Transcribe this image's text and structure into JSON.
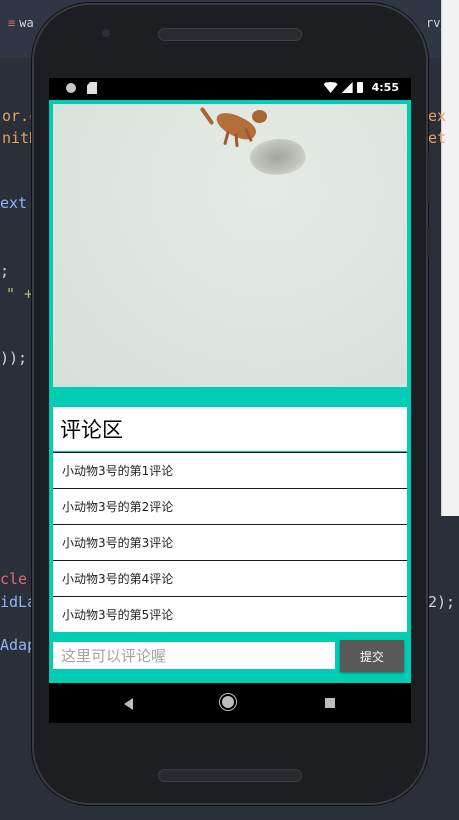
{
  "ide": {
    "tab_left": "wa",
    "tab_right": "rv_",
    "code_fragments": [
      {
        "text": "or.c",
        "color": "#e5a15a"
      },
      {
        "text": "nitD",
        "color": "#e5a15a"
      },
      {
        "text": "ext",
        "color": "#8fb4f5"
      },
      {
        "text": ";",
        "color": "#cfd3dc"
      },
      {
        "text": "\" +",
        "color": "#a5c17b"
      },
      {
        "text": "));",
        "color": "#cfd3dc"
      },
      {
        "text": "cle",
        "color": "#e06c75"
      },
      {
        "text": "idLa",
        "color": "#8fb4f5"
      },
      {
        "text": "Adap",
        "color": "#8fb4f5"
      },
      {
        "text": "ex",
        "color": "#e5a15a"
      },
      {
        "text": "et",
        "color": "#e5a15a"
      },
      {
        "text": "2);",
        "color": "#cfd3dc"
      }
    ]
  },
  "status_bar": {
    "time": "4:55"
  },
  "app": {
    "background_color": "#00cdb6",
    "image_label": "cat-photo",
    "comments_title": "评论区",
    "comments": [
      "小动物3号的第1评论",
      "小动物3号的第2评论",
      "小动物3号的第3评论",
      "小动物3号的第4评论",
      "小动物3号的第5评论"
    ],
    "input_placeholder": "这里可以评论喔",
    "input_value": "",
    "submit_label": "提交"
  },
  "navigation": {
    "back_icon": "back-triangle-icon",
    "home_icon": "home-circle-icon",
    "recents_icon": "recents-square-icon"
  }
}
